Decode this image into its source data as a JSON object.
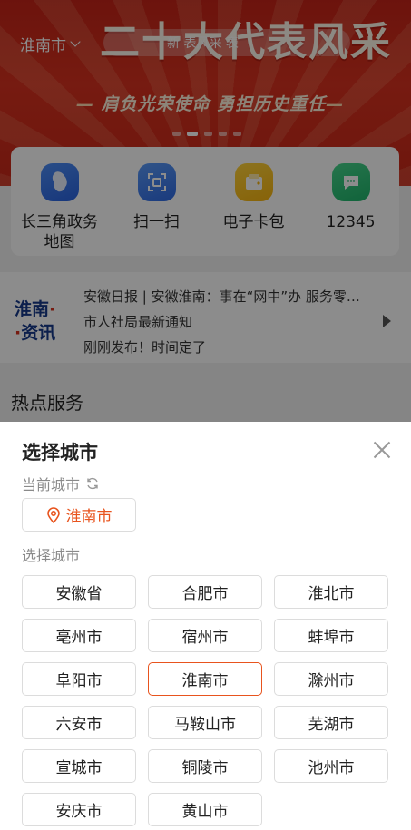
{
  "background": {
    "banner": {
      "headline": "二十大代表风采",
      "subline": "肩负光荣使命  勇担历史重任",
      "city_selector": "淮南市",
      "search_text": "新 表风采  表"
    },
    "quick_services": [
      {
        "label": "长三角政务地图",
        "icon": "map-icon"
      },
      {
        "label": "扫一扫",
        "icon": "scan-icon"
      },
      {
        "label": "电子卡包",
        "icon": "wallet-icon"
      },
      {
        "label": "12345",
        "icon": "chat-icon"
      }
    ],
    "news": {
      "logo_top": "淮南",
      "logo_bottom": "资讯",
      "items": [
        "安徽日报 | 安徽淮南：事在“网中”办 服务零…",
        "市人社局最新通知",
        "刚刚发布！时间定了"
      ]
    },
    "hot_services_title": "热点服务"
  },
  "sheet": {
    "title": "选择城市",
    "current_label": "当前城市",
    "current_city": "淮南市",
    "select_label": "选择城市",
    "cities": [
      "安徽省",
      "合肥市",
      "淮北市",
      "亳州市",
      "宿州市",
      "蚌埠市",
      "阜阳市",
      "淮南市",
      "滁州市",
      "六安市",
      "马鞍山市",
      "芜湖市",
      "宣城市",
      "铜陵市",
      "池州市",
      "安庆市",
      "黄山市"
    ],
    "selected_city": "淮南市",
    "accent_color": "#e8541e"
  }
}
